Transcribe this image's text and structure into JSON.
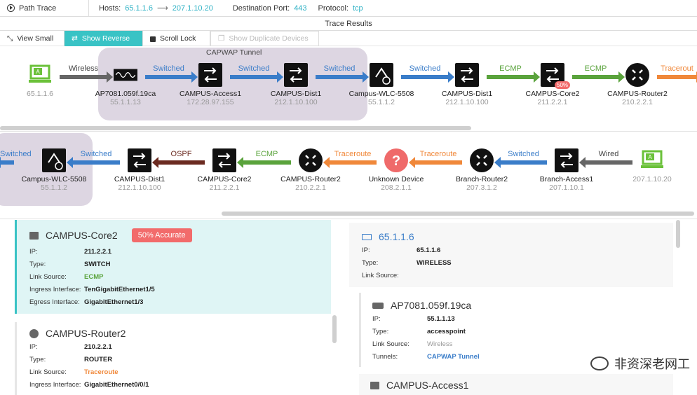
{
  "header": {
    "path_trace": "Path Trace",
    "hosts_label": "Hosts:",
    "hosts_src": "65.1.1.6",
    "hosts_dst": "207.1.10.20",
    "dest_port_label": "Destination Port:",
    "dest_port": "443",
    "protocol_label": "Protocol:",
    "protocol": "tcp"
  },
  "title": "Trace Results",
  "toolbar": {
    "view_small": "View Small",
    "show_reverse": "Show Reverse",
    "scroll_lock": "Scroll Lock",
    "show_duplicates": "Show Duplicate Devices"
  },
  "forward": {
    "tunnel_label": "CAPWAP Tunnel",
    "nodes": [
      {
        "name": "",
        "ip": "65.1.1.6",
        "type": "host"
      },
      {
        "name": "AP7081.059f.19ca",
        "ip": "55.1.1.13",
        "type": "ap"
      },
      {
        "name": "CAMPUS-Access1",
        "ip": "172.28.97.155",
        "type": "switch"
      },
      {
        "name": "CAMPUS-Dist1",
        "ip": "212.1.10.100",
        "type": "switch"
      },
      {
        "name": "Campus-WLC-5508",
        "ip": "55.1.1.2",
        "type": "wlc"
      },
      {
        "name": "CAMPUS-Dist1",
        "ip": "212.1.10.100",
        "type": "switch"
      },
      {
        "name": "CAMPUS-Core2",
        "ip": "211.2.2.1",
        "type": "switch",
        "badge": "50%"
      },
      {
        "name": "CAMPUS-Router2",
        "ip": "210.2.2.1",
        "type": "router"
      }
    ],
    "edges": [
      {
        "label": "Wireless",
        "color": "#666666"
      },
      {
        "label": "Switched",
        "color": "#3a7dc9"
      },
      {
        "label": "Switched",
        "color": "#3a7dc9"
      },
      {
        "label": "Switched",
        "color": "#3a7dc9"
      },
      {
        "label": "Switched",
        "color": "#3a7dc9"
      },
      {
        "label": "ECMP",
        "color": "#5aa33c"
      },
      {
        "label": "ECMP",
        "color": "#5aa33c"
      },
      {
        "label": "Tracerout",
        "color": "#f0883a"
      }
    ]
  },
  "reverse": {
    "nodes": [
      {
        "name": "Campus-WLC-5508",
        "ip": "55.1.1.2",
        "type": "wlc"
      },
      {
        "name": "CAMPUS-Dist1",
        "ip": "212.1.10.100",
        "type": "switch"
      },
      {
        "name": "CAMPUS-Core2",
        "ip": "211.2.2.1",
        "type": "switch"
      },
      {
        "name": "CAMPUS-Router2",
        "ip": "210.2.2.1",
        "type": "router"
      },
      {
        "name": "Unknown Device",
        "ip": "208.2.1.1",
        "type": "unknown"
      },
      {
        "name": "Branch-Router2",
        "ip": "207.3.1.2",
        "type": "router"
      },
      {
        "name": "Branch-Access1",
        "ip": "207.1.10.1",
        "type": "switch"
      },
      {
        "name": "",
        "ip": "207.1.10.20",
        "type": "host"
      }
    ],
    "edges": [
      {
        "label": "Switched",
        "color": "#3a7dc9"
      },
      {
        "label": "Switched",
        "color": "#3a7dc9"
      },
      {
        "label": "OSPF",
        "color": "#6b2a20"
      },
      {
        "label": "ECMP",
        "color": "#5aa33c"
      },
      {
        "label": "Traceroute",
        "color": "#f0883a"
      },
      {
        "label": "Traceroute",
        "color": "#f0883a"
      },
      {
        "label": "Switched",
        "color": "#3a7dc9"
      },
      {
        "label": "Wired",
        "color": "#666666"
      }
    ]
  },
  "details_left": [
    {
      "name": "CAMPUS-Core2",
      "badge": "50% Accurate",
      "rows": [
        {
          "k": "IP:",
          "v": "211.2.2.1"
        },
        {
          "k": "Type:",
          "v": "SWITCH"
        },
        {
          "k": "Link Source:",
          "v": "ECMP"
        },
        {
          "k": "Ingress Interface:",
          "v": "TenGigabitEthernet1/5"
        },
        {
          "k": "Egress Interface:",
          "v": "GigabitEthernet1/3"
        }
      ]
    },
    {
      "name": "CAMPUS-Router2",
      "rows": [
        {
          "k": "IP:",
          "v": "210.2.2.1"
        },
        {
          "k": "Type:",
          "v": "ROUTER"
        },
        {
          "k": "Link Source:",
          "v": "Traceroute"
        },
        {
          "k": "Ingress Interface:",
          "v": "GigabitEthernet0/0/1"
        }
      ]
    }
  ],
  "details_right": [
    {
      "name": "65.1.1.6",
      "rows": [
        {
          "k": "IP:",
          "v": "65.1.1.6"
        },
        {
          "k": "Type:",
          "v": "WIRELESS"
        },
        {
          "k": "Link Source:",
          "v": ""
        }
      ]
    },
    {
      "name": "AP7081.059f.19ca",
      "rows": [
        {
          "k": "IP:",
          "v": "55.1.1.13"
        },
        {
          "k": "Type:",
          "v": "accesspoint"
        },
        {
          "k": "Link Source:",
          "v": "Wireless"
        },
        {
          "k": "Tunnels:",
          "v": "CAPWAP Tunnel"
        }
      ]
    },
    {
      "name": "CAMPUS-Access1"
    }
  ],
  "watermark": "非资深老网工",
  "colors": {
    "accent": "#39c3c5",
    "highlight": "#ddd6e2",
    "badge": "#f26b6b",
    "selected_card": "#dff5f5",
    "link": "#2fb2c5"
  }
}
